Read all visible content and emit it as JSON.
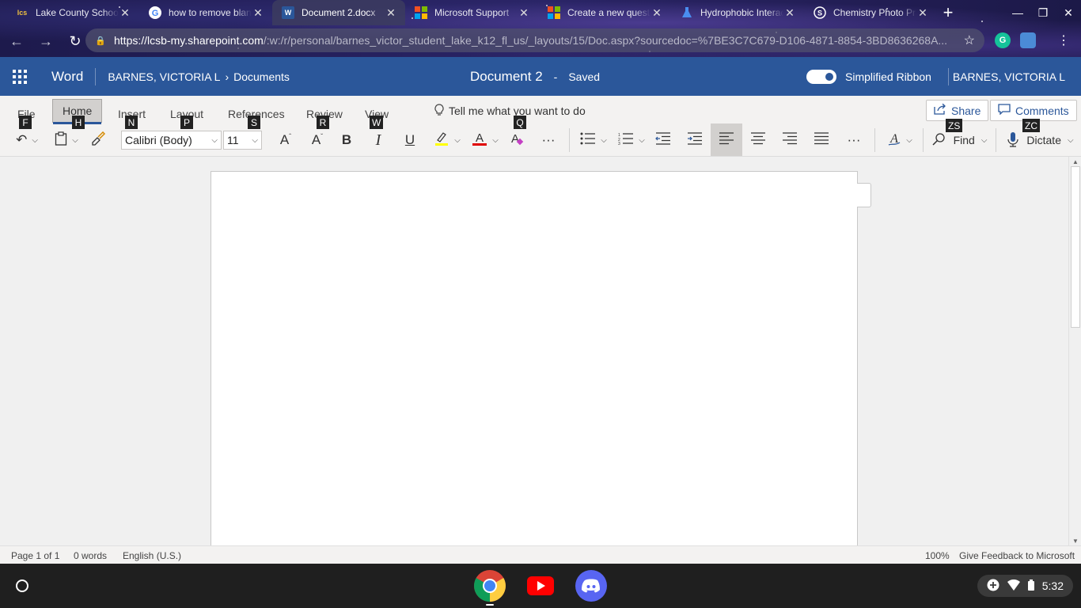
{
  "browser": {
    "tabs": [
      {
        "title": "Lake County Schools",
        "favicon": "lcs-logo-icon"
      },
      {
        "title": "how to remove blank page",
        "favicon": "google-icon"
      },
      {
        "title": "Document 2.docx",
        "favicon": "word-icon",
        "active": true
      },
      {
        "title": "Microsoft Support",
        "favicon": "microsoft-icon"
      },
      {
        "title": "Create a new question",
        "favicon": "microsoft-icon"
      },
      {
        "title": "Hydrophobic Interactions",
        "favicon": "flask-icon"
      },
      {
        "title": "Chemistry Photo Problem",
        "favicon": "socratic-icon"
      }
    ],
    "url_host": "https://lcsb-my.sharepoint.com",
    "url_path": "/:w:/r/personal/barnes_victor_student_lake_k12_fl_us/_layouts/15/Doc.aspx?sourcedoc=%7BE3C7C679-D106-4871-8854-3BD8636268A..."
  },
  "word": {
    "app_name": "Word",
    "breadcrumb_owner": "BARNES, VICTORIA L",
    "breadcrumb_folder": "Documents",
    "doc_title": "Document 2",
    "save_sep": "-",
    "save_status": "Saved",
    "simplified_ribbon_label": "Simplified Ribbon",
    "user_name": "BARNES, VICTORIA L"
  },
  "ribbon": {
    "tabs": [
      "File",
      "Home",
      "Insert",
      "Layout",
      "References",
      "Review",
      "View"
    ],
    "keytips": [
      "F",
      "H",
      "N",
      "P",
      "S",
      "R",
      "W",
      "Q",
      "ZS",
      "ZC"
    ],
    "tell_me": "Tell me what you want to do",
    "share": "Share",
    "comments": "Comments",
    "font_name": "Calibri (Body)",
    "font_size": "11",
    "find": "Find",
    "dictate": "Dictate"
  },
  "status": {
    "page": "Page 1 of 1",
    "words": "0 words",
    "language": "English (U.S.)",
    "zoom": "100%",
    "feedback": "Give Feedback to Microsoft"
  },
  "shelf": {
    "time": "5:32",
    "apps": [
      "chrome-icon",
      "youtube-icon",
      "discord-icon"
    ]
  },
  "colors": {
    "word_blue": "#2b579a",
    "highlight_yellow": "#ffff00",
    "font_color_red": "#e00000"
  }
}
